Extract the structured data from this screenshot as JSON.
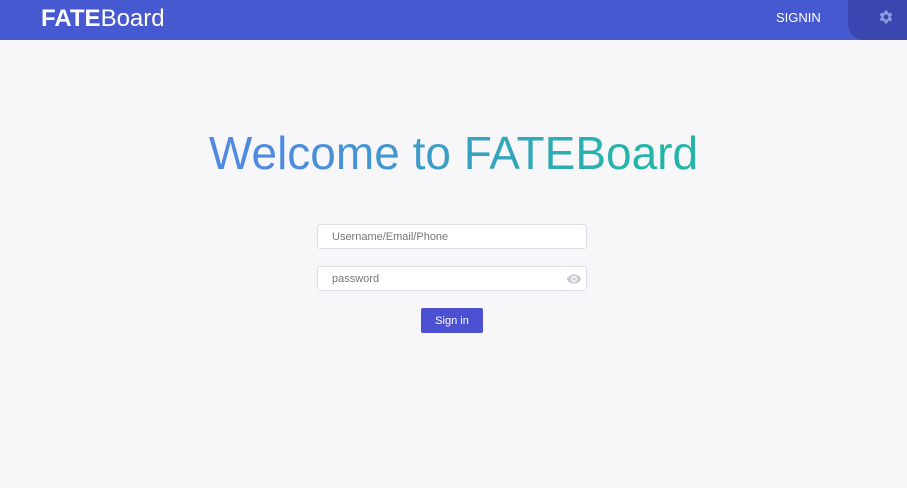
{
  "header": {
    "logo_bold": "FATE",
    "logo_light": "Board",
    "signin_label": "SIGNIN",
    "settings_icon": "gear-icon",
    "background_color": "#4759d1",
    "tab_color": "#3946b0"
  },
  "main": {
    "welcome_title": "Welcome to FATEBoard",
    "username": {
      "placeholder": "Username/Email/Phone",
      "value": ""
    },
    "password": {
      "placeholder": "password",
      "value": "",
      "toggle_icon": "eye-icon"
    },
    "signin_button_label": "Sign in",
    "button_color": "#4b51d1"
  }
}
